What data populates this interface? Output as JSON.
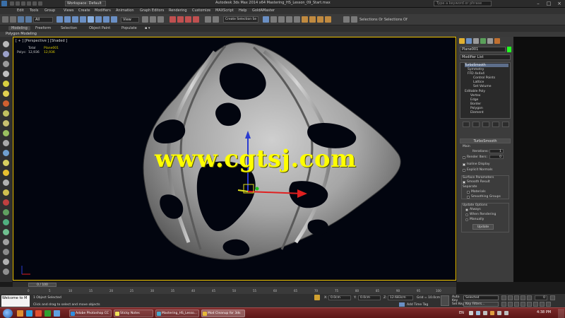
{
  "titlebar": {
    "workspace": "Workspace: Default",
    "app_title": "Autodesk 3ds Max 2014 x64    Mastering_HS_Lesson_09_Start.max",
    "search_placeholder": "Type a keyword or phrase"
  },
  "menu": [
    "Edit",
    "Tools",
    "Group",
    "Views",
    "Create",
    "Modifiers",
    "Animation",
    "Graph Editors",
    "Rendering",
    "Customize",
    "MAXScript",
    "Help",
    "GoldAMaster"
  ],
  "toolbar": {
    "selection_filter": "All",
    "view_select": "View",
    "named_selection": "Create Selection Se",
    "selection_of": "Selections Or Selections Of"
  },
  "ribbon": {
    "tabs": [
      "Modeling",
      "Freeform",
      "Selection",
      "Object Paint",
      "Populate"
    ],
    "active_tab": "Modeling",
    "sub_label": "Polygon Modeling"
  },
  "viewport": {
    "label": "[ + ] [Perspective ] [Shaded ]",
    "stats_total": "Total",
    "stats_object": "Plane001",
    "polys_label": "Polys:",
    "polys_total": "12,936",
    "polys_object": "12,936",
    "watermark": "www.cgtsj.com"
  },
  "command_panel": {
    "object_name": "Plane001",
    "object_color": "#22ff22",
    "modifier_list": "Modifier List",
    "stack": [
      {
        "label": "TurboSmooth",
        "indent": 0,
        "selected": true
      },
      {
        "label": "Symmetry",
        "indent": 0,
        "selected": false
      },
      {
        "label": "FFD 4x4x4",
        "indent": 0,
        "selected": false
      },
      {
        "label": "Control Points",
        "indent": 1,
        "selected": false
      },
      {
        "label": "Lattice",
        "indent": 1,
        "selected": false
      },
      {
        "label": "Set Volume",
        "indent": 1,
        "selected": false
      },
      {
        "label": "Editable Poly",
        "indent": 0,
        "selected": false
      },
      {
        "label": "Vertex",
        "indent": 1,
        "selected": false
      },
      {
        "label": "Edge",
        "indent": 1,
        "selected": false
      },
      {
        "label": "Border",
        "indent": 1,
        "selected": false
      },
      {
        "label": "Polygon",
        "indent": 1,
        "selected": false
      },
      {
        "label": "Element",
        "indent": 1,
        "selected": false
      }
    ],
    "rollout_title": "TurboSmooth",
    "main_label": "Main",
    "iterations_label": "Iterations:",
    "iterations_value": "1",
    "render_iters_label": "Render Iters:",
    "render_iters_value": "0",
    "isoline_label": "Isoline Display",
    "explicit_normals_label": "Explicit Normals",
    "surface_params_label": "Surface Parameters",
    "smooth_result_label": "Smooth Result",
    "separate_label": "Separate",
    "materials_label": "Materials",
    "smoothing_groups_label": "Smoothing Groups",
    "update_options_label": "Update Options",
    "always_label": "Always",
    "when_rendering_label": "When Rendering",
    "manually_label": "Manually",
    "update_button": "Update"
  },
  "timeline": {
    "slider": "0 / 100",
    "ticks": [
      "0",
      "5",
      "10",
      "15",
      "20",
      "25",
      "30",
      "35",
      "40",
      "45",
      "50",
      "55",
      "60",
      "65",
      "70",
      "75",
      "80",
      "85",
      "90",
      "95",
      "100"
    ]
  },
  "status": {
    "maxscript": "Welcome to M",
    "objects_selected": "1 Object Selected",
    "prompt": "Click and drag to select and move objects",
    "x_label": "X:",
    "x_value": "0.0cm",
    "y_label": "Y:",
    "y_value": "0.0cm",
    "z_label": "Z:",
    "z_value": "12.683cm",
    "grid": "Grid = 10.0cm",
    "add_time_tag": "Add Time Tag",
    "auto_key": "Auto Key",
    "selected": "Selected",
    "set_key": "Set Key",
    "key_filters": "Key Filters...",
    "frame": "0"
  },
  "taskbar": {
    "items": [
      {
        "label": "Adobe Photoshop CC",
        "color": "#2f8ee0"
      },
      {
        "label": "Sticky Notes",
        "color": "#f2e25a"
      },
      {
        "label": "Mastering_HS_Lesso...",
        "color": "#4aa7c9"
      },
      {
        "label": "Mod Cleanup for 3ds",
        "color": "#e7b93a"
      }
    ],
    "language": "EN",
    "time": "4:38 PM"
  }
}
